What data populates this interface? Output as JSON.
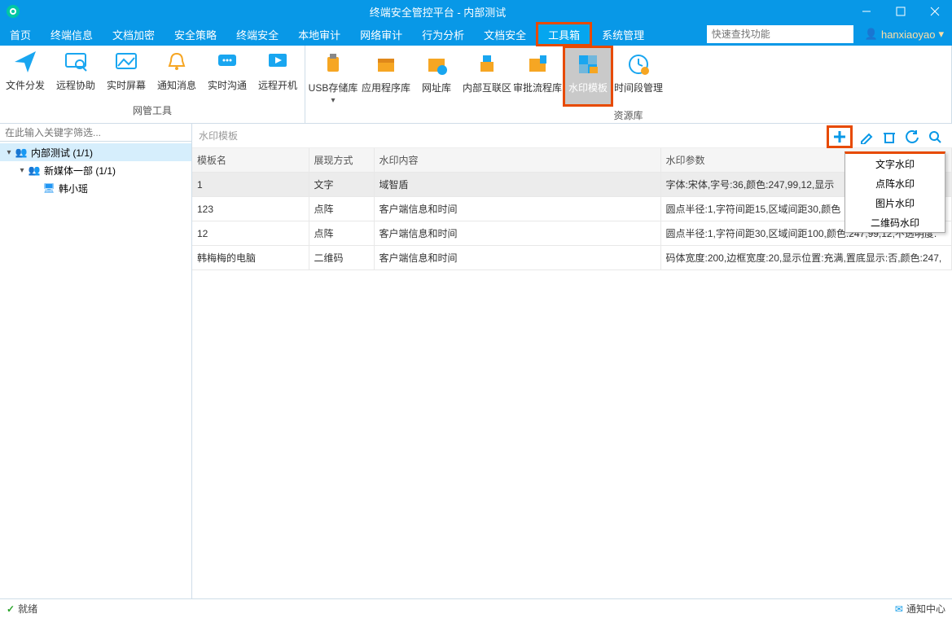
{
  "titlebar": {
    "title": "终端安全管控平台 - 内部测试"
  },
  "menubar": {
    "items": [
      "首页",
      "终端信息",
      "文档加密",
      "安全策略",
      "终端安全",
      "本地审计",
      "网络审计",
      "行为分析",
      "文档安全",
      "工具箱",
      "系统管理"
    ],
    "search_placeholder": "快速查找功能",
    "user": "hanxiaoyao"
  },
  "ribbon": {
    "group1_label": "网管工具",
    "group1": [
      "文件分发",
      "远程协助",
      "实时屏幕",
      "通知消息",
      "实时沟通",
      "远程开机"
    ],
    "group2_label": "资源库",
    "group2": [
      "USB存储库",
      "应用程序库",
      "网址库",
      "内部互联区",
      "审批流程库",
      "水印模板",
      "时间段管理"
    ]
  },
  "sidebar": {
    "filter_placeholder": "在此输入关键字筛选...",
    "root": "内部测试 (1/1)",
    "dept": "新媒体一部 (1/1)",
    "leaf": "韩小瑶"
  },
  "main": {
    "crumb": "水印模板",
    "cols": [
      "模板名",
      "展现方式",
      "水印内容",
      "水印参数"
    ],
    "rows": [
      {
        "name": "1",
        "mode": "文字",
        "content": "域智盾",
        "params": "字体:宋体,字号:36,颜色:247,99,12,显示"
      },
      {
        "name": "123",
        "mode": "点阵",
        "content": "客户端信息和时间",
        "params": "圆点半径:1,字符间距15,区域间距30,颜色"
      },
      {
        "name": "12",
        "mode": "点阵",
        "content": "客户端信息和时间",
        "params": "圆点半径:1,字符间距30,区域间距100,颜色:247,99,12,不透明度:"
      },
      {
        "name": "韩梅梅的电脑",
        "mode": "二维码",
        "content": "客户端信息和时间",
        "params": "码体宽度:200,边框宽度:20,显示位置:充满,置底显示:否,颜色:247,"
      }
    ],
    "dropdown": [
      "文字水印",
      "点阵水印",
      "图片水印",
      "二维码水印"
    ]
  },
  "statusbar": {
    "ready": "就绪",
    "notify": "通知中心"
  }
}
